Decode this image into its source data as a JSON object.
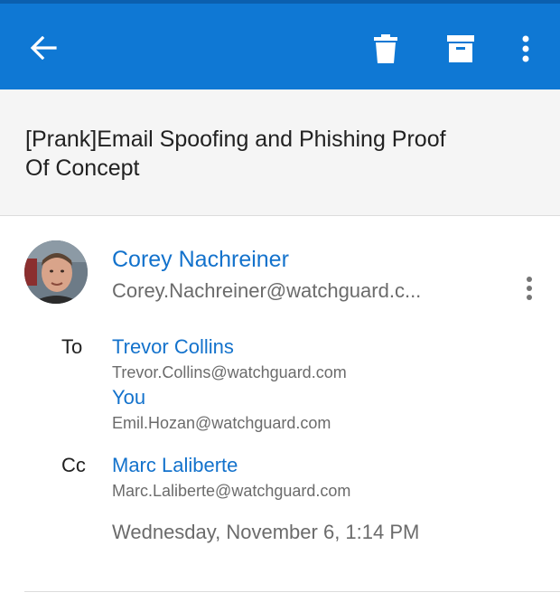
{
  "toolbar": {
    "back_icon": "arrow-left-icon",
    "delete_icon": "trash-icon",
    "archive_icon": "archive-icon",
    "more_icon": "more-vertical-icon",
    "background_color": "#0f78d4"
  },
  "message": {
    "subject": "[Prank]Email Spoofing and Phishing Proof Of Concept",
    "sender": {
      "name": "Corey Nachreiner",
      "email": "Corey.Nachreiner@watchguard.c..."
    },
    "to_label": "To",
    "to": [
      {
        "name": "Trevor Collins",
        "email": "Trevor.Collins@watchguard.com"
      },
      {
        "name": "You",
        "email": "Emil.Hozan@watchguard.com"
      }
    ],
    "cc_label": "Cc",
    "cc": [
      {
        "name": "Marc Laliberte",
        "email": "Marc.Laliberte@watchguard.com"
      }
    ],
    "date": "Wednesday, November 6, 1:14 PM"
  },
  "colors": {
    "accent": "#1372cc",
    "secondary_text": "#6b6b6b"
  }
}
